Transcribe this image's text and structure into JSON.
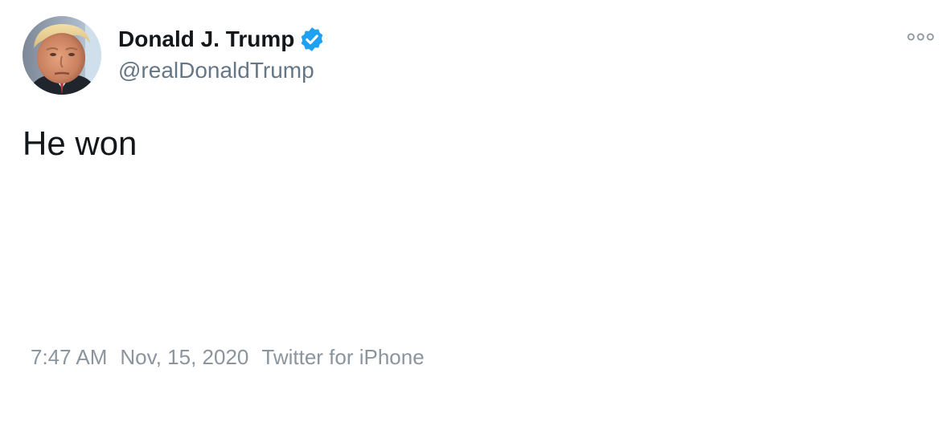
{
  "tweet": {
    "author": {
      "display_name": "Donald J. Trump",
      "handle": "@realDonaldTrump",
      "verified": true,
      "avatar_icon": "profile-photo",
      "verified_icon": "verified-badge-icon"
    },
    "text": "He won",
    "time": "7:47 AM",
    "date": "Nov, 15, 2020",
    "source": "Twitter for iPhone",
    "more_icon": "more-options-icon"
  },
  "colors": {
    "text_primary": "#14171a",
    "text_secondary": "#657786",
    "meta_text": "#8b959e",
    "verified_blue": "#1da1f2",
    "background": "#ffffff"
  }
}
